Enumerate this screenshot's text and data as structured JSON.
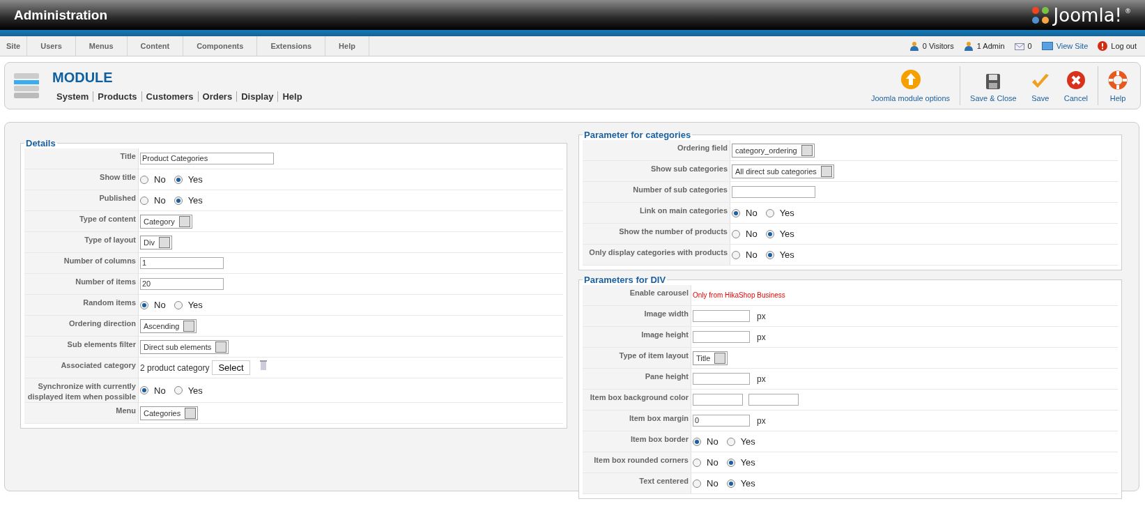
{
  "header": {
    "title": "Administration",
    "logo": "Joomla!",
    "logo_mark": "®"
  },
  "menu": [
    {
      "label": "Site"
    },
    {
      "label": "Users"
    },
    {
      "label": "Menus"
    },
    {
      "label": "Content"
    },
    {
      "label": "Components"
    },
    {
      "label": "Extensions"
    },
    {
      "label": "Help"
    }
  ],
  "status": [
    {
      "kind": "visitors",
      "label": "0 Visitors"
    },
    {
      "kind": "admin",
      "label": "1 Admin"
    },
    {
      "kind": "messages",
      "label": "0"
    },
    {
      "kind": "view",
      "label": "View Site"
    },
    {
      "kind": "logout",
      "label": "Log out"
    }
  ],
  "toolbar": {
    "title": "MODULE",
    "tabs": [
      "System",
      "Products",
      "Customers",
      "Orders",
      "Display",
      "Help"
    ],
    "buttons": [
      {
        "kind": "options",
        "label": "Joomla module options"
      },
      {
        "kind": "save-close",
        "label": "Save & Close"
      },
      {
        "kind": "save",
        "label": "Save"
      },
      {
        "kind": "cancel",
        "label": "Cancel"
      },
      {
        "kind": "help",
        "label": "Help"
      }
    ]
  },
  "details": {
    "legend": "Details",
    "rows": [
      {
        "label": "Title",
        "kind": "text",
        "value": "Product Categories"
      },
      {
        "label": "Show title",
        "kind": "radio",
        "options": [
          {
            "label": "No",
            "selected": false
          },
          {
            "label": "Yes",
            "selected": true
          }
        ]
      },
      {
        "label": "Published",
        "kind": "radio",
        "options": [
          {
            "label": "No",
            "selected": false
          },
          {
            "label": "Yes",
            "selected": true
          }
        ]
      },
      {
        "label": "Type of content",
        "kind": "select",
        "value": "Category"
      },
      {
        "label": "Type of layout",
        "kind": "select",
        "value": "Div"
      },
      {
        "label": "Number of columns",
        "kind": "text",
        "value": "1"
      },
      {
        "label": "Number of items",
        "kind": "text",
        "value": "20"
      },
      {
        "label": "Random items",
        "kind": "radio",
        "options": [
          {
            "label": "No",
            "selected": true
          },
          {
            "label": "Yes",
            "selected": false
          }
        ]
      },
      {
        "label": "Ordering direction",
        "kind": "select",
        "value": "Ascending"
      },
      {
        "label": "Sub elements filter",
        "kind": "select",
        "value": "Direct sub elements"
      },
      {
        "label": "Associated category",
        "kind": "category",
        "value": "2 product category",
        "button": "Select"
      },
      {
        "label": "Synchronize with currently displayed item when possible",
        "kind": "radio",
        "options": [
          {
            "label": "No",
            "selected": true
          },
          {
            "label": "Yes",
            "selected": false
          }
        ]
      },
      {
        "label": "Menu",
        "kind": "select",
        "value": "Categories"
      }
    ]
  },
  "categories": {
    "legend": "Parameter for categories",
    "rows": [
      {
        "label": "Ordering field",
        "kind": "select",
        "value": "category_ordering"
      },
      {
        "label": "Show sub categories",
        "kind": "select",
        "value": "All direct sub categories"
      },
      {
        "label": "Number of sub categories",
        "kind": "text"
      },
      {
        "label": "Link on main categories",
        "kind": "radio",
        "options": [
          {
            "label": "No",
            "selected": true
          },
          {
            "label": "Yes",
            "selected": false
          }
        ]
      },
      {
        "label": "Show the number of products",
        "kind": "radio",
        "options": [
          {
            "label": "No",
            "selected": false
          },
          {
            "label": "Yes",
            "selected": true
          }
        ]
      },
      {
        "label": "Only display categories with products",
        "kind": "radio",
        "options": [
          {
            "label": "No",
            "selected": false
          },
          {
            "label": "Yes",
            "selected": true
          }
        ]
      }
    ]
  },
  "div": {
    "legend": "Parameters for DIV",
    "rows": [
      {
        "label": "Enable carousel",
        "kind": "note",
        "value": "Only from HikaShop Business"
      },
      {
        "label": "Image width",
        "kind": "text",
        "unit": "px"
      },
      {
        "label": "Image height",
        "kind": "text",
        "unit": "px"
      },
      {
        "label": "Type of item layout",
        "kind": "select",
        "value": "Title"
      },
      {
        "label": "Pane height",
        "kind": "text",
        "unit": "px"
      },
      {
        "label": "Item box background color",
        "kind": "color"
      },
      {
        "label": "Item box margin",
        "kind": "text",
        "value": "0",
        "unit": "px"
      },
      {
        "label": "Item box border",
        "kind": "radio",
        "options": [
          {
            "label": "No",
            "selected": true
          },
          {
            "label": "Yes",
            "selected": false
          }
        ]
      },
      {
        "label": "Item box rounded corners",
        "kind": "radio",
        "options": [
          {
            "label": "No",
            "selected": false
          },
          {
            "label": "Yes",
            "selected": true
          }
        ]
      },
      {
        "label": "Text centered",
        "kind": "radio",
        "options": [
          {
            "label": "No",
            "selected": false
          },
          {
            "label": "Yes",
            "selected": true
          }
        ]
      }
    ]
  }
}
